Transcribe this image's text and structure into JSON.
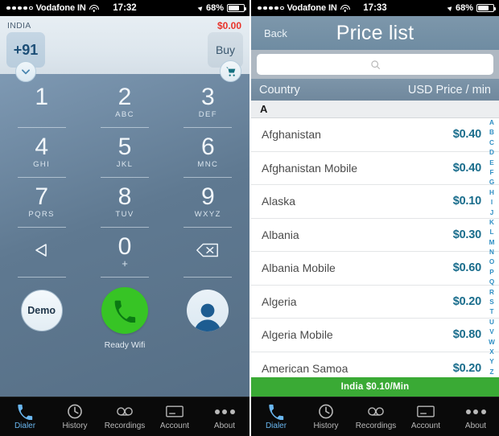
{
  "left": {
    "statusbar": {
      "carrier": "Vodafone IN",
      "time": "17:32",
      "battery": "68%"
    },
    "header": {
      "country_label": "INDIA",
      "country_code": "+91",
      "balance": "$0.00",
      "buy_label": "Buy"
    },
    "keypad": [
      {
        "num": "1",
        "sub": ""
      },
      {
        "num": "2",
        "sub": "ABC"
      },
      {
        "num": "3",
        "sub": "DEF"
      },
      {
        "num": "4",
        "sub": "GHI"
      },
      {
        "num": "5",
        "sub": "JKL"
      },
      {
        "num": "6",
        "sub": "MNC"
      },
      {
        "num": "7",
        "sub": "PQRS"
      },
      {
        "num": "8",
        "sub": "TUV"
      },
      {
        "num": "9",
        "sub": "WXYZ"
      },
      {
        "num": "0",
        "sub": "+"
      }
    ],
    "actions": {
      "demo_label": "Demo",
      "status_label": "Ready Wifi"
    }
  },
  "right": {
    "statusbar": {
      "carrier": "Vodafone IN",
      "time": "17:33",
      "battery": "68%"
    },
    "navbar": {
      "back_label": "Back",
      "title": "Price list"
    },
    "search": {
      "value": "",
      "placeholder": ""
    },
    "columns": {
      "country": "Country",
      "price": "USD Price / min"
    },
    "section_letter": "A",
    "rows": [
      {
        "country": "Afghanistan",
        "price": "$0.40"
      },
      {
        "country": "Afghanistan Mobile",
        "price": "$0.40"
      },
      {
        "country": "Alaska",
        "price": "$0.10"
      },
      {
        "country": "Albania",
        "price": "$0.30"
      },
      {
        "country": "Albania Mobile",
        "price": "$0.60"
      },
      {
        "country": "Algeria",
        "price": "$0.20"
      },
      {
        "country": "Algeria Mobile",
        "price": "$0.80"
      },
      {
        "country": "American Samoa",
        "price": "$0.20"
      }
    ],
    "index": [
      "A",
      "B",
      "C",
      "D",
      "E",
      "F",
      "G",
      "H",
      "I",
      "J",
      "K",
      "L",
      "M",
      "N",
      "O",
      "P",
      "Q",
      "R",
      "S",
      "T",
      "U",
      "V",
      "W",
      "X",
      "Y",
      "Z"
    ],
    "footer": "India  $0.10/Min"
  },
  "tabs": [
    {
      "label": "Dialer",
      "icon": "phone-icon",
      "active": true
    },
    {
      "label": "History",
      "icon": "clock-icon",
      "active": false
    },
    {
      "label": "Recordings",
      "icon": "voicemail-icon",
      "active": false
    },
    {
      "label": "Account",
      "icon": "card-icon",
      "active": false
    },
    {
      "label": "About",
      "icon": "ellipsis-icon",
      "active": false
    }
  ],
  "colors": {
    "accent_blue": "#6ab7f0",
    "call_green": "#37c425",
    "footer_green": "#3aaa35",
    "balance_red": "#e8332a",
    "price_teal": "#1a6d8c"
  }
}
